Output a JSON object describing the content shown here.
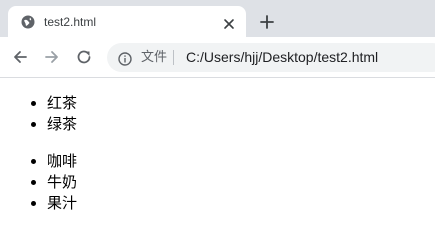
{
  "tab": {
    "title": "test2.html",
    "favicon": "globe-icon",
    "close_icon": "close-icon"
  },
  "newtab_icon": "plus-icon",
  "toolbar": {
    "back_icon": "back-arrow-icon",
    "forward_icon": "forward-arrow-icon",
    "reload_icon": "reload-icon"
  },
  "omnibox": {
    "info_icon": "info-icon",
    "security_label": "文件",
    "url": "C:/Users/hjj/Desktop/test2.html"
  },
  "page": {
    "list1": [
      "红茶",
      "绿茶"
    ],
    "list2": [
      "咖啡",
      "牛奶",
      "果汁"
    ]
  },
  "colors": {
    "tabstrip": "#dee1e6",
    "omnibox": "#f1f3f4",
    "icon": "#5f6368",
    "disabled_icon": "#9aa0a6"
  }
}
